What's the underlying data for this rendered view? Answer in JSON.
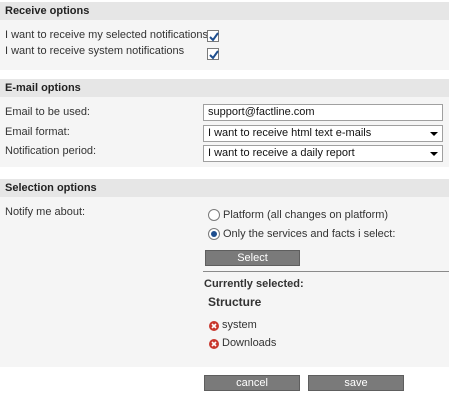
{
  "receive": {
    "header": "Receive options",
    "selected_notifications_label": "I want to receive my selected notifications",
    "selected_notifications_checked": true,
    "system_notifications_label": "I want to receive system notifications",
    "system_notifications_checked": true
  },
  "email": {
    "header": "E-mail options",
    "address_label": "Email to be used:",
    "address_value": "support@factline.com",
    "format_label": "Email format:",
    "format_value": "I want to receive html text e-mails",
    "period_label": "Notification period:",
    "period_value": "I want to receive a daily report"
  },
  "selection": {
    "header": "Selection options",
    "notify_label": "Notify me about:",
    "option_platform": "Platform (all changes on platform)",
    "option_selected": "Only the services and facts i select:",
    "selected_option": "option_selected",
    "select_button": "Select",
    "currently_selected_label": "Currently selected:",
    "group_title": "Structure",
    "items": [
      "system",
      "Downloads"
    ]
  },
  "actions": {
    "cancel": "cancel",
    "save": "save"
  },
  "colors": {
    "header_bg": "#e6e6e6",
    "panel_bg": "#f5f5f5",
    "button_bg": "#7a7a7a",
    "check_color": "#1f4f8f",
    "remove_icon": "#c8372d"
  }
}
